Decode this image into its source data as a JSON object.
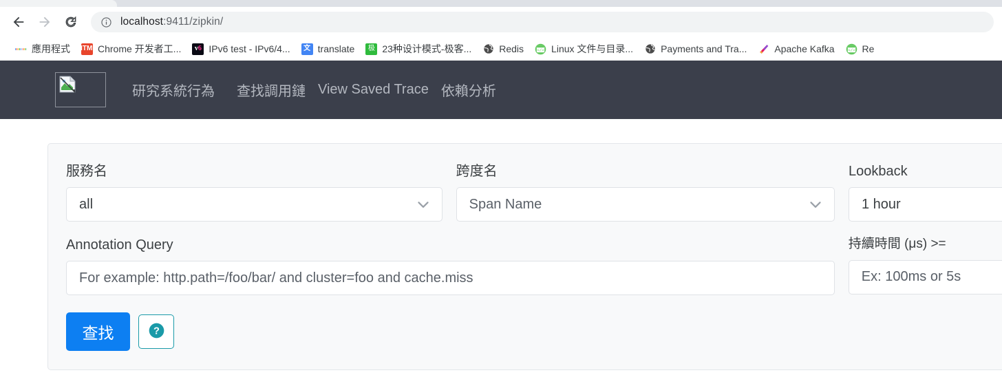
{
  "browser": {
    "back_label": "Back",
    "forward_label": "Forward",
    "reload_label": "Reload",
    "site_info_label": "View site information",
    "url": "localhost:9411/zipkin/",
    "url_host": "localhost",
    "url_path": ":9411/zipkin/",
    "bookmarks": [
      {
        "label": "應用程式",
        "icon": "apps-grid-icon"
      },
      {
        "label": "Chrome 开发者工...",
        "icon": "html5-icon"
      },
      {
        "label": "IPv6 test - IPv6/4...",
        "icon": "v6-icon"
      },
      {
        "label": "translate",
        "icon": "google-translate-icon"
      },
      {
        "label": "23种设计模式-极客...",
        "icon": "jikeshijian-icon"
      },
      {
        "label": "Redis",
        "icon": "globe-icon"
      },
      {
        "label": "Linux 文件与目录...",
        "icon": "code-window-icon"
      },
      {
        "label": "Payments and Tra...",
        "icon": "globe-icon"
      },
      {
        "label": "Apache Kafka",
        "icon": "kafka-icon"
      },
      {
        "label": "Re",
        "icon": "code-window-icon"
      }
    ]
  },
  "zipkin": {
    "logo_alt": "broken-image-icon",
    "nav_links": [
      {
        "label": "研究系統行為"
      },
      {
        "label": "查找調用鏈"
      },
      {
        "label": "View Saved Trace"
      },
      {
        "label": "依賴分析"
      }
    ],
    "search": {
      "service_name": {
        "label": "服務名",
        "value": "all"
      },
      "span_name": {
        "label": "跨度名",
        "placeholder": "Span Name"
      },
      "lookback": {
        "label": "Lookback",
        "value": "1 hour"
      },
      "annotation_query": {
        "label": "Annotation Query",
        "placeholder": "For example: http.path=/foo/bar/ and cluster=foo and cache.miss"
      },
      "duration": {
        "label": "持續時間 (μs) >=",
        "placeholder": "Ex: 100ms or 5s"
      },
      "find_button": "查找",
      "help_button": "?"
    }
  },
  "colors": {
    "navbar_bg": "#3b3f4b",
    "primary_button": "#0d7ff2",
    "help_accent": "#1a9aa8",
    "panel_bg": "#f8f9fa"
  }
}
